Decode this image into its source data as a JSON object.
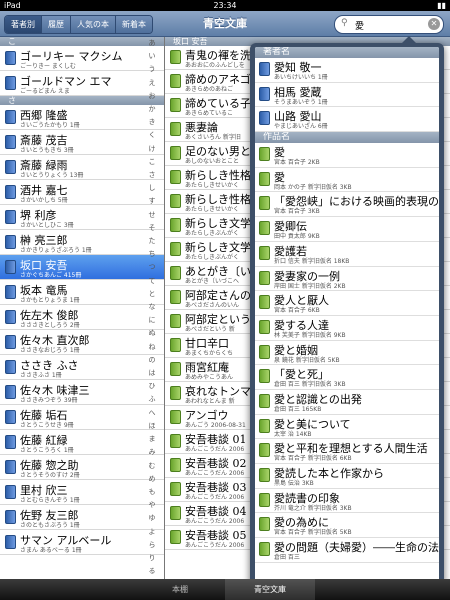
{
  "status": {
    "device": "iPad",
    "time": "23:34"
  },
  "nav": {
    "segments": [
      "著者別",
      "履歴",
      "人気の本",
      "新着本"
    ],
    "title": "青空文庫",
    "search_value": "愛"
  },
  "authors": {
    "section_top": "こ",
    "items_top": [
      {
        "name": "ゴーリキー マクシム",
        "reading": "ごーりきー まくしむ"
      },
      {
        "name": "ゴールドマン エマ",
        "reading": "ごーるどまん えま"
      }
    ],
    "section_sa": "さ",
    "items": [
      {
        "name": "西郷 隆盛",
        "reading": "さいごうたかもり 1冊"
      },
      {
        "name": "斎藤 茂吉",
        "reading": "さいとうもきち 3冊"
      },
      {
        "name": "斎藤 緑雨",
        "reading": "さいとうりょくう 13冊"
      },
      {
        "name": "酒井 嘉七",
        "reading": "さかいかしち 5冊"
      },
      {
        "name": "堺 利彦",
        "reading": "さかいとしひこ 3冊"
      },
      {
        "name": "榊 亮三郎",
        "reading": "さかきりょうざぶろう 1冊"
      },
      {
        "name": "坂口 安吾",
        "reading": "さかぐちあんご 415冊",
        "selected": true
      },
      {
        "name": "坂本 竜馬",
        "reading": "さかもとりょうま 1冊"
      },
      {
        "name": "佐左木 俊郎",
        "reading": "さささきとしろう 2冊"
      },
      {
        "name": "佐々木 直次郎",
        "reading": "ささきなおじろう 1冊"
      },
      {
        "name": "ささき ふさ",
        "reading": "ささきふさ 1冊"
      },
      {
        "name": "佐々木 味津三",
        "reading": "ささきみつぞう 39冊"
      },
      {
        "name": "佐藤 垢石",
        "reading": "さとうこうせき 9冊"
      },
      {
        "name": "佐藤 紅緑",
        "reading": "さとうこうろく 1冊"
      },
      {
        "name": "佐藤 惣之助",
        "reading": "さとうそうのすけ 2冊"
      },
      {
        "name": "里村 欣三",
        "reading": "さとむらきんぞう 1冊"
      },
      {
        "name": "佐野 友三郎",
        "reading": "さのともさぶろう 1冊"
      },
      {
        "name": "サマン アルベール",
        "reading": "さまん あるべーる 1冊"
      }
    ],
    "kana_index": [
      "あ",
      "い",
      "う",
      "え",
      "お",
      "か",
      "き",
      "く",
      "け",
      "こ",
      "さ",
      "し",
      "す",
      "せ",
      "そ",
      "た",
      "ち",
      "つ",
      "て",
      "と",
      "な",
      "に",
      "ぬ",
      "ね",
      "の",
      "は",
      "ひ",
      "ふ",
      "へ",
      "ほ",
      "ま",
      "み",
      "む",
      "め",
      "も",
      "や",
      "ゆ",
      "よ",
      "ら",
      "り",
      "る",
      "れ"
    ]
  },
  "works": {
    "header": "坂口 安吾",
    "items": [
      {
        "title": "青鬼の褌を洗う",
        "meta": "あおおにのふんどしを"
      },
      {
        "title": "諦めのアネゴ",
        "meta": "あきらめのあねご"
      },
      {
        "title": "諦めている子",
        "meta": "あきらめているこ"
      },
      {
        "title": "悪妻論",
        "meta": "あくさいろん 新字旧"
      },
      {
        "title": "足のない男と",
        "meta": "あしのないおとこと"
      },
      {
        "title": "新らしき性格",
        "meta": "あたらしきせいかく"
      },
      {
        "title": "新らしき性格",
        "meta": "あたらしきせいかく"
      },
      {
        "title": "新らしき文学",
        "meta": "あたらしきぶんがく"
      },
      {
        "title": "新らしき文学",
        "meta": "あたらしきぶんがく"
      },
      {
        "title": "あとがき〔い",
        "meta": "あとがき〔いづこへ"
      },
      {
        "title": "阿部定さんの",
        "meta": "あべさださんのいん"
      },
      {
        "title": "阿部定という",
        "meta": "あべさだという 新"
      },
      {
        "title": "甘口辛口",
        "meta": "あまくちからくち"
      },
      {
        "title": "雨宮紅庵",
        "meta": "あめみやこうあん"
      },
      {
        "title": "哀れなトンマ",
        "meta": "あわれなとんま 新"
      },
      {
        "title": "アンゴウ",
        "meta": "あんごう 2006-08-31"
      },
      {
        "title": "安吾巷談 01",
        "meta": "あんごこうだん 2006"
      },
      {
        "title": "安吾巷談 02",
        "meta": "あんごこうだん 2006"
      },
      {
        "title": "安吾巷談 03",
        "meta": "あんごこうだん 2006"
      },
      {
        "title": "安吾巷談 04",
        "meta": "あんごこうだん 2006"
      },
      {
        "title": "安吾巷談 05",
        "meta": "あんごこうだん 2006"
      }
    ]
  },
  "popover": {
    "author_header": "著者名",
    "authors": [
      {
        "name": "愛知 敬一",
        "reading": "あいちけいいち 1冊"
      },
      {
        "name": "相馬 愛蔵",
        "reading": "そうまあいぞう 1冊"
      },
      {
        "name": "山路 愛山",
        "reading": "やまじあいざん 6冊"
      }
    ],
    "work_header": "作品名",
    "works": [
      {
        "title": "愛",
        "meta": "宮本 百合子 2KB"
      },
      {
        "title": "愛",
        "meta": "岡本 かの子 新字旧仮名 3KB"
      },
      {
        "title": "「愛怨峡」における映画的表現の問題",
        "meta": "宮本 百合子 3KB"
      },
      {
        "title": "愛卿伝",
        "meta": "田中 貢太郎 9KB"
      },
      {
        "title": "愛護若",
        "meta": "折口 信夫 新字旧仮名 18KB"
      },
      {
        "title": "愛妻家の一例",
        "meta": "岸田 国士 新字旧仮名 2KB"
      },
      {
        "title": "愛人と厭人",
        "meta": "宮本 百合子 6KB"
      },
      {
        "title": "愛する人達",
        "meta": "林 芙美子 新字旧仮名 9KB"
      },
      {
        "title": "愛と婚姻",
        "meta": "泉 鏡花 新字旧仮名 5KB"
      },
      {
        "title": "「愛と死」",
        "meta": "倉田 百三 新字旧仮名 3KB"
      },
      {
        "title": "愛と認識との出発",
        "meta": "倉田 百三 165KB"
      },
      {
        "title": "愛と美について",
        "meta": "太宰 治 14KB"
      },
      {
        "title": "愛と平和を理想とする人間生活",
        "meta": "宮本 百合子 新字旧仮名 6KB"
      },
      {
        "title": "愛読した本と作家から",
        "meta": "黒島 伝治 3KB"
      },
      {
        "title": "愛読書の印象",
        "meta": "芥川 竜之介 新字旧仮名 3KB"
      },
      {
        "title": "愛の為めに",
        "meta": "宮本 百合子 新字旧仮名 5KB"
      },
      {
        "title": "愛の問題（夫婦愛）――生命の法に随う――",
        "meta": "倉田 百三"
      }
    ]
  },
  "tabbar": {
    "tabs": [
      "本棚",
      "青空文庫"
    ]
  }
}
